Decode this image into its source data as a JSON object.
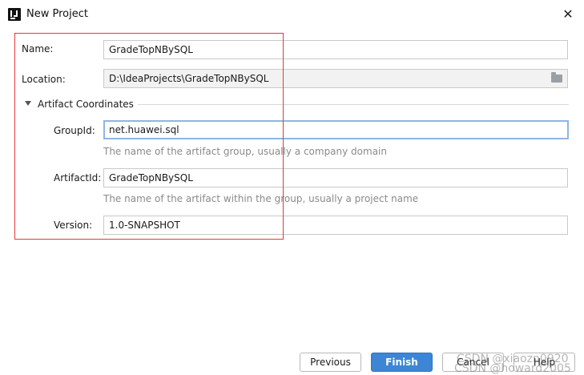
{
  "window": {
    "title": "New Project",
    "close_glyph": "✕"
  },
  "form": {
    "name": {
      "label": "Name:",
      "value": "GradeTopNBySQL"
    },
    "location": {
      "label": "Location:",
      "value": "D:\\IdeaProjects\\GradeTopNBySQL",
      "icon": "folder-icon"
    },
    "section": {
      "title": "Artifact Coordinates",
      "expanded": true
    },
    "group_id": {
      "label": "GroupId:",
      "value": "net.huawei.sql",
      "hint": "The name of the artifact group, usually a company domain"
    },
    "artifact_id": {
      "label": "ArtifactId:",
      "value": "GradeTopNBySQL",
      "hint": "The name of the artifact within the group, usually a project name"
    },
    "version": {
      "label": "Version:",
      "value": "1.0-SNAPSHOT"
    }
  },
  "annotation": {
    "color": "#e53935"
  },
  "buttons": {
    "previous": "Previous",
    "finish": "Finish",
    "cancel": "Cancel",
    "help": "Help"
  },
  "watermarks": {
    "line1": "CSDN @xiaozn0920",
    "line2": "CSDN @howard2005"
  },
  "colors": {
    "primary_button": "#3d86d6",
    "focus_border": "#8fb6e3",
    "hint_text": "#8a8a8a"
  }
}
